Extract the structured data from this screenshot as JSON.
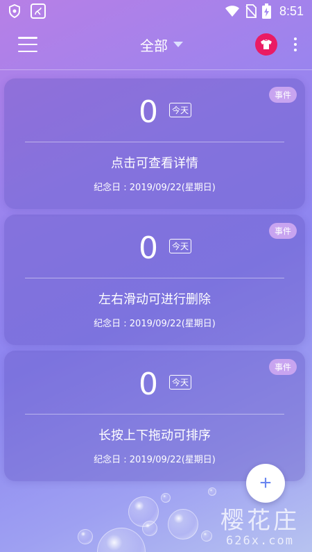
{
  "status_bar": {
    "time": "8:51",
    "left_icons": [
      "vpn-shield-icon",
      "app-notification-icon"
    ],
    "right_icons": [
      "wifi-icon",
      "no-sim-icon",
      "battery-charging-icon"
    ]
  },
  "toolbar": {
    "title": "全部",
    "icons": [
      "menu-icon",
      "caret-down-icon",
      "shirt-theme-icon",
      "more-vert-icon"
    ]
  },
  "cards": [
    {
      "tag": "事件",
      "count": "0",
      "today": "今天",
      "description": "点击可查看详情",
      "date_line": "纪念日 : 2019/09/22(星期日)"
    },
    {
      "tag": "事件",
      "count": "0",
      "today": "今天",
      "description": "左右滑动可进行删除",
      "date_line": "纪念日 : 2019/09/22(星期日)"
    },
    {
      "tag": "事件",
      "count": "0",
      "today": "今天",
      "description": "长按上下拖动可排序",
      "date_line": "纪念日 : 2019/09/22(星期日)"
    }
  ],
  "fab": {
    "label": "+"
  },
  "watermark": {
    "main": "樱花庄",
    "sub": "626x.com"
  },
  "colors": {
    "accent_pink": "#ea1b64",
    "tag_bg": "#c8a4f0",
    "fab_plus": "#6a86f0"
  }
}
